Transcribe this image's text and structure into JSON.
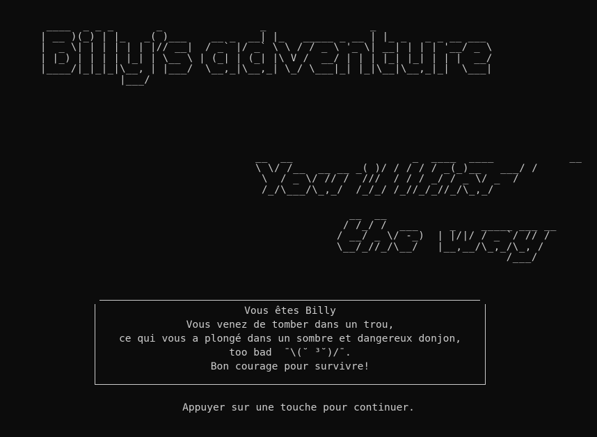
{
  "title_art": " ____  _ _ _       _                _                 _\n| __ )(_) | |_   _( )___    __ _  __| |_   _____ _ __ | |_ _   _ _ __ ___\n|  _ \\| | | | | | |// __|  / _` |/ _` \\ \\ / / _ \\ '_ \\| __| | | | '__/ _ \\\n| |_) | | | | |_| | \\__ \\ | (_| | (_| |\\ V /  __/ | | | |_| |_| | | |  __/\n|____/|_|_|_|\\__, | |___/  \\__,_|\\__,_| \\_/ \\___|_| |_|\\__|\\__,_|_|  \\___|\n             |___/",
  "subtitle_art_1": "__  __                   _  ____  ____            __\n\\ \\/ /__  __ __ _( )/ / / / / _(_)__   ___/ /\n \\  / _ \\/ // /  ///  / / / _/ / _ \\/ _  /\n /_/\\___/\\_,_/  /_/_/ /_//_/_//_/\\_,_/",
  "subtitle_art_2": "  __  __\n / /_/ /  ___     _    _____ ___ __\n/ __/ _ \\/ -_)  | |/|/ / _ `/ // /\n\\__/_//_/\\__/   |__,__/\\_,_/\\_, /\n                           /___/",
  "message_box": {
    "line_1": "Vous êtes Billy",
    "line_2": "Vous venez de tomber dans un trou,",
    "line_3": "ce qui vous a plongé dans un sombre et dangereux donjon,",
    "line_4": "too bad  ¯\\(˘ ³˘)/¯.",
    "line_5": "Bon courage pour survivre!"
  },
  "continue_prompt": "Appuyer sur une touche pour continuer.",
  "colors": {
    "background": "#0c0c0c",
    "foreground": "#cccccc"
  }
}
